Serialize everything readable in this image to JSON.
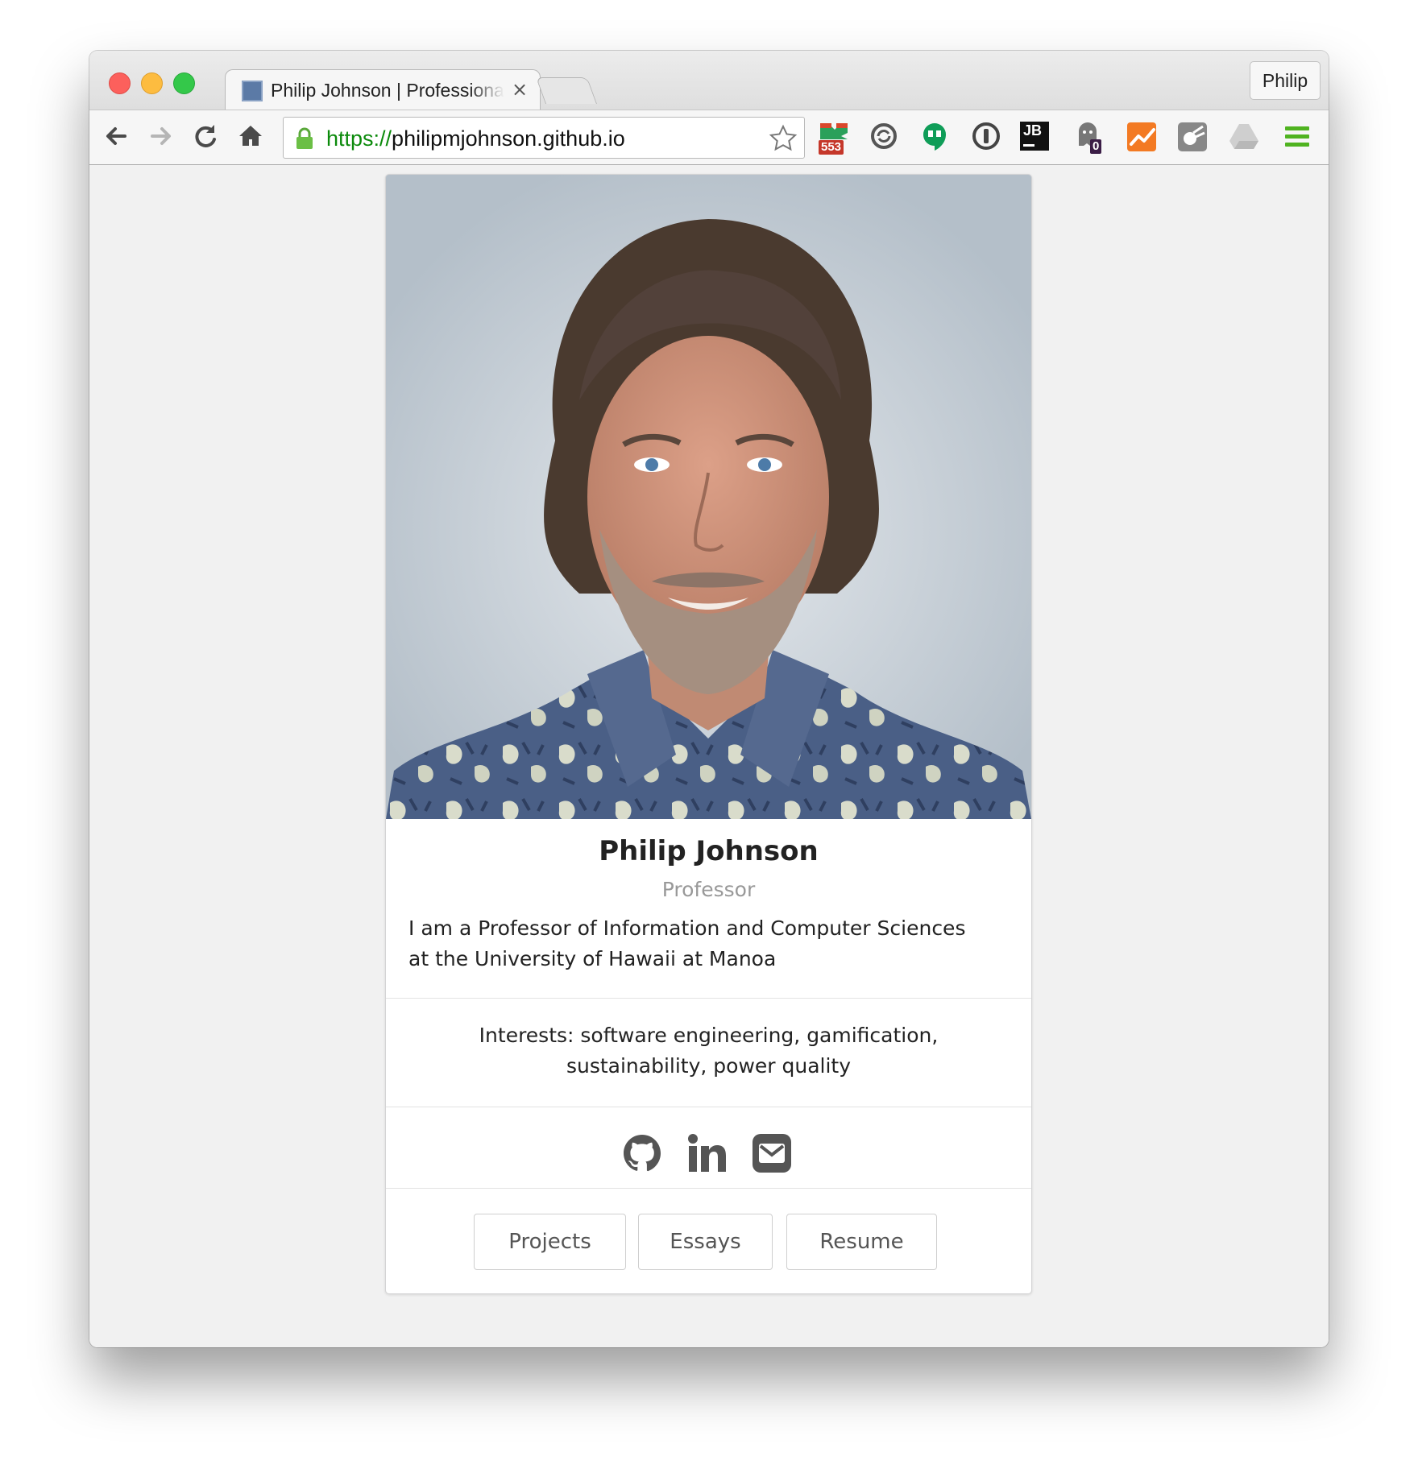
{
  "browser": {
    "tab_title": "Philip Johnson | Professional Portfolio",
    "tab_close": "×",
    "profile_label": "Philip",
    "url_scheme": "https://",
    "url_host": "philipmjohnson.github.io",
    "extensions": [
      {
        "name": "gitlab-icon",
        "badge": "553"
      },
      {
        "name": "sync-icon"
      },
      {
        "name": "hangouts-icon"
      },
      {
        "name": "1password-icon"
      },
      {
        "name": "jetbrains-icon",
        "label": "JB"
      },
      {
        "name": "ghostery-icon",
        "badge": "0"
      },
      {
        "name": "analytics-icon"
      },
      {
        "name": "comet-icon"
      },
      {
        "name": "drive-icon"
      },
      {
        "name": "menu-icon"
      }
    ]
  },
  "profile": {
    "name": "Philip Johnson",
    "role": "Professor",
    "description_line1": "I am a Professor of Information and Computer Sciences",
    "description_line2": "at the University of Hawaii at Manoa",
    "interests_line1": "Interests: software engineering, gamification,",
    "interests_line2": "sustainability, power quality",
    "social": [
      "github-icon",
      "linkedin-icon",
      "email-icon"
    ],
    "buttons": {
      "projects": "Projects",
      "essays": "Essays",
      "resume": "Resume"
    }
  },
  "colors": {
    "traffic_red": "#fc605c",
    "traffic_yellow": "#fdbc40",
    "traffic_green": "#34c84a",
    "url_scheme": "#0b8a0b",
    "page_bg": "#f1f1f1"
  }
}
